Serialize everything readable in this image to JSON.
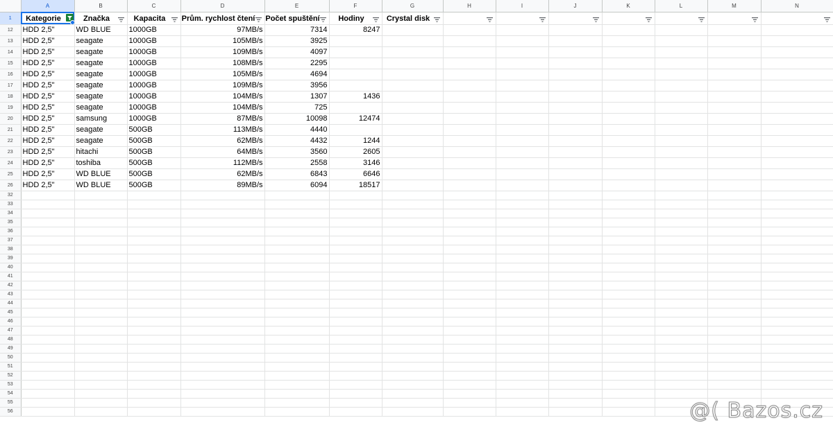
{
  "columns": [
    "A",
    "B",
    "C",
    "D",
    "E",
    "F",
    "G",
    "H",
    "I",
    "J",
    "K",
    "L",
    "M",
    "N"
  ],
  "header_row_number": "1",
  "headers": [
    "Kategorie",
    "Značka",
    "Kapacita",
    "Prům. rychlost čtení",
    "Počet spuštění",
    "Hodiny",
    "Crystal disk",
    "",
    "",
    "",
    "",
    "",
    "",
    ""
  ],
  "rows": [
    {
      "n": "12",
      "cells": [
        "HDD 2,5\"",
        "WD BLUE",
        "1000GB",
        "97MB/s",
        "7314",
        "8247",
        ""
      ]
    },
    {
      "n": "13",
      "cells": [
        "HDD 2,5\"",
        "seagate",
        "1000GB",
        "105MB/s",
        "3925",
        "",
        ""
      ]
    },
    {
      "n": "14",
      "cells": [
        "HDD 2,5\"",
        "seagate",
        "1000GB",
        "109MB/s",
        "4097",
        "",
        ""
      ]
    },
    {
      "n": "15",
      "cells": [
        "HDD 2,5\"",
        "seagate",
        "1000GB",
        "108MB/s",
        "2295",
        "",
        ""
      ]
    },
    {
      "n": "16",
      "cells": [
        "HDD 2,5\"",
        "seagate",
        "1000GB",
        "105MB/s",
        "4694",
        "",
        ""
      ]
    },
    {
      "n": "17",
      "cells": [
        "HDD 2,5\"",
        "seagate",
        "1000GB",
        "109MB/s",
        "3956",
        "",
        ""
      ]
    },
    {
      "n": "18",
      "cells": [
        "HDD 2,5\"",
        "seagate",
        "1000GB",
        "104MB/s",
        "1307",
        "1436",
        ""
      ]
    },
    {
      "n": "19",
      "cells": [
        "HDD 2,5\"",
        "seagate",
        "1000GB",
        "104MB/s",
        "725",
        "",
        ""
      ]
    },
    {
      "n": "20",
      "cells": [
        "HDD 2,5\"",
        "samsung",
        "1000GB",
        "87MB/s",
        "10098",
        "12474",
        ""
      ]
    },
    {
      "n": "21",
      "cells": [
        "HDD 2,5\"",
        "seagate",
        "500GB",
        "113MB/s",
        "4440",
        "",
        ""
      ]
    },
    {
      "n": "22",
      "cells": [
        "HDD 2,5\"",
        "seagate",
        "500GB",
        "62MB/s",
        "4432",
        "1244",
        ""
      ]
    },
    {
      "n": "23",
      "cells": [
        "HDD 2,5\"",
        "hitachi",
        "500GB",
        "64MB/s",
        "3560",
        "2605",
        ""
      ]
    },
    {
      "n": "24",
      "cells": [
        "HDD 2,5\"",
        "toshiba",
        "500GB",
        "112MB/s",
        "2558",
        "3146",
        ""
      ]
    },
    {
      "n": "25",
      "cells": [
        "HDD 2,5\"",
        "WD BLUE",
        "500GB",
        "62MB/s",
        "6843",
        "6646",
        ""
      ]
    },
    {
      "n": "26",
      "cells": [
        "HDD 2,5\"",
        "WD BLUE",
        "500GB",
        "89MB/s",
        "6094",
        "18517",
        ""
      ]
    }
  ],
  "empty_rows": [
    "32",
    "33",
    "34",
    "35",
    "36",
    "37",
    "38",
    "39",
    "40",
    "41",
    "42",
    "43",
    "44",
    "45",
    "46",
    "47",
    "48",
    "49",
    "50",
    "51",
    "52",
    "53",
    "54",
    "55",
    "56"
  ],
  "watermark": "@( Bazos.cz",
  "colors": {
    "selection": "#1a73e8",
    "filter_active": "#188038",
    "header_bg": "#f8f9fa",
    "selected_header_bg": "#d3e3fd"
  },
  "icons": {
    "filter": "filter-icon",
    "filter_active": "filter-active-icon"
  }
}
